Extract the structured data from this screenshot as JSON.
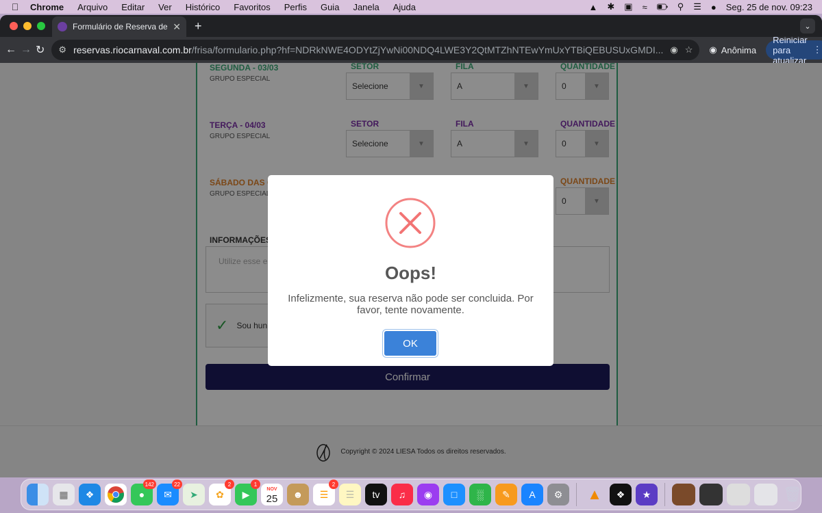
{
  "menubar": {
    "app": "Chrome",
    "items": [
      "Arquivo",
      "Editar",
      "Ver",
      "Histórico",
      "Favoritos",
      "Perfis",
      "Guia",
      "Janela",
      "Ajuda"
    ],
    "clock": "Seg. 25 de nov.  09:23"
  },
  "browser": {
    "tab_title": "Formulário de Reserva de Frisa",
    "url_host": "reservas.riocarnaval.com.br",
    "url_rest": "/frisa/formulario.php?hf=NDRkNWE4ODYtZjYwNi00NDQ4LWE3Y2QtMTZhNTEwYmUxYTBiQEBUSUxGMDI...",
    "incognito_label": "Anônima",
    "restart_label": "Reiniciar para atualizar"
  },
  "form": {
    "rows": [
      {
        "day": "SEGUNDA - 03/03",
        "sub": "GRUPO ESPECIAL",
        "setor_label": "SETOR",
        "setor": "Selecione",
        "fila_label": "FILA",
        "fila": "A",
        "qtd_label": "QUANTIDADE",
        "qtd": "0"
      },
      {
        "day": "TERÇA - 04/03",
        "sub": "GRUPO ESPECIAL",
        "setor_label": "SETOR",
        "setor": "Selecione",
        "fila_label": "FILA",
        "fila": "A",
        "qtd_label": "QUANTIDADE",
        "qtd": "0"
      },
      {
        "day": "SÁBADO DAS CA",
        "sub": "GRUPO ESPECIAL",
        "qtd_label": "QUANTIDADE",
        "qtd": "0"
      }
    ],
    "info_label": "INFORMAÇÕES A",
    "textarea_placeholder": "Utilize esse es",
    "captcha_label": "Sou hun",
    "confirm_label": "Confirmar"
  },
  "footer": {
    "copyright": "Copyright © 2024 LIESA Todos os direitos reservados."
  },
  "modal": {
    "title": "Oops!",
    "message": "Infelizmente, sua reserva não pode ser concluida. Por favor, tente novamente.",
    "ok_label": "OK"
  },
  "dock": {
    "badges": {
      "messages": "142",
      "mail": "22",
      "photos": "2",
      "facetime": "1",
      "reminders": "2"
    },
    "calendar_month": "NOV",
    "calendar_day": "25"
  },
  "colors": {
    "green_day": "#3aa876",
    "purple_day": "#7b2fa8",
    "orange_day": "#e0822a",
    "confirm_bg": "#1c1a5c",
    "ok_bg": "#3b82d9",
    "error_red": "#f27474"
  }
}
